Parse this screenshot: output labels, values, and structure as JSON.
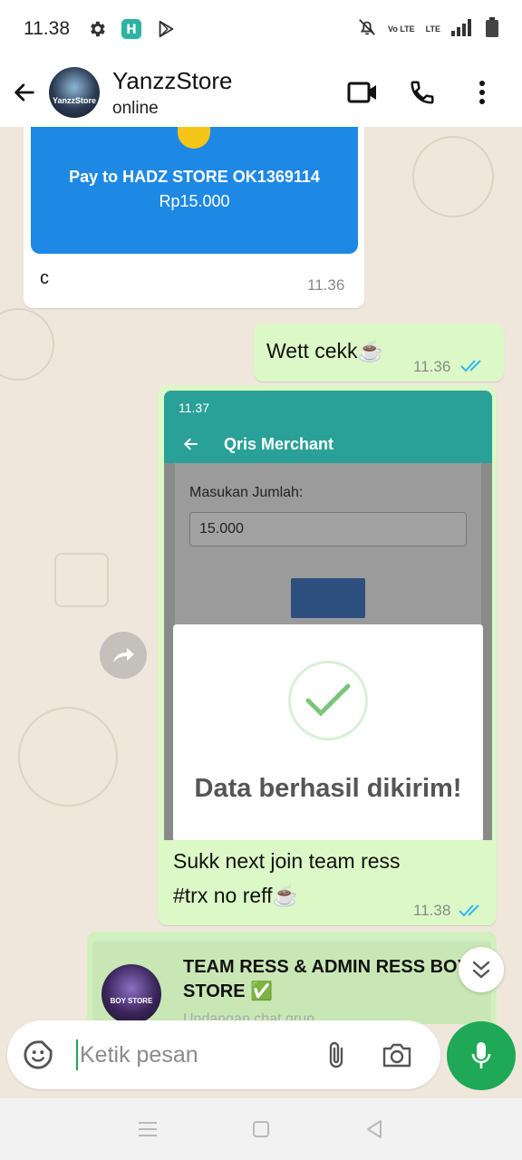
{
  "status_bar": {
    "time": "11.38",
    "network_label_1": "Vo LTE",
    "network_label_2": "LTE"
  },
  "header": {
    "contact_name": "YanzzStore",
    "contact_status": "online",
    "avatar_label": "YanzzStore"
  },
  "messages": {
    "payment_card": {
      "title": "Pay to HADZ STORE OK1369114",
      "amount": "Rp15.000",
      "caption": "c",
      "time": "11.36"
    },
    "wett": {
      "text": "Wett cekk☕",
      "time": "11.36"
    },
    "screenshot": {
      "status_time": "11.37",
      "app_title": "Qris Merchant",
      "label": "Masukan Jumlah:",
      "input_value": "15.000",
      "dialog_text": "Data berhasil dikirim!"
    },
    "sukk": {
      "line1": "Sukk next join team ress",
      "line2": "#trx no reff☕",
      "time": "11.38"
    },
    "group_invite": {
      "name": "TEAM RESS & ADMIN RESS BOY STORE ✅",
      "subtitle": "Undangan chat grup",
      "avatar_label": "BOY STORE"
    }
  },
  "composer": {
    "placeholder": "Ketik pesan"
  },
  "colors": {
    "accent_green": "#1fa855",
    "bubble_out": "#dcf8c6",
    "read_ticks": "#34b7f1",
    "payment_blue": "#1e88e5"
  }
}
